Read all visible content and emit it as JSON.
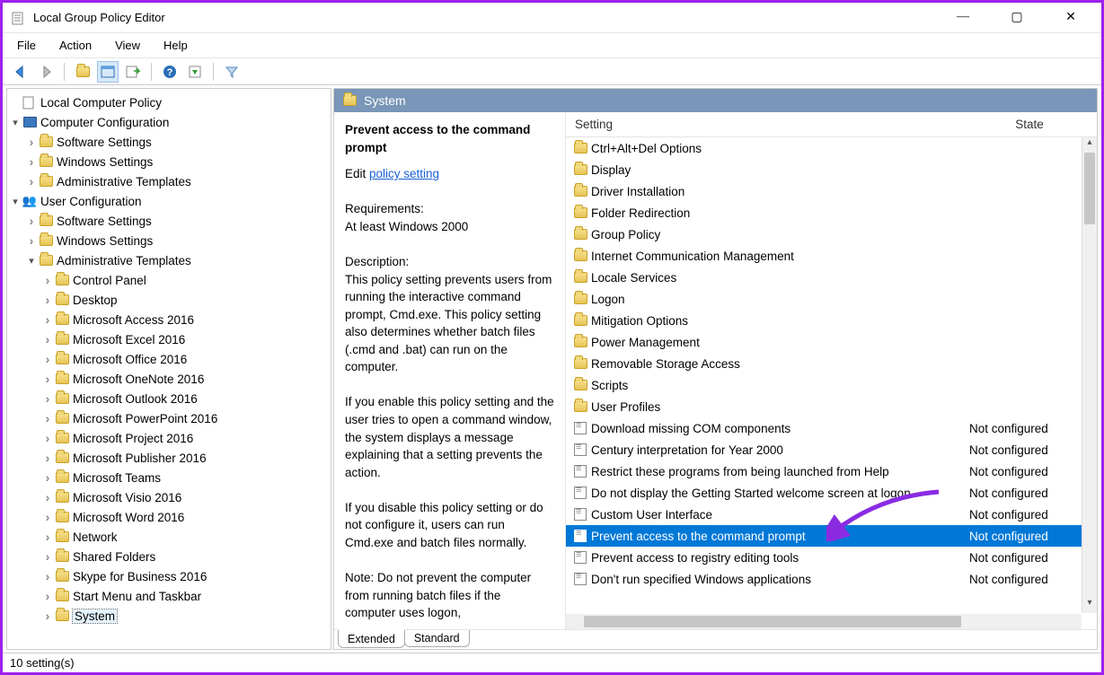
{
  "window": {
    "title": "Local Group Policy Editor",
    "controls": {
      "min": "—",
      "max": "▢",
      "close": "✕"
    }
  },
  "menu": [
    "File",
    "Action",
    "View",
    "Help"
  ],
  "tree": {
    "root": "Local Computer Policy",
    "computer_cfg": "Computer Configuration",
    "cc_children": [
      "Software Settings",
      "Windows Settings",
      "Administrative Templates"
    ],
    "user_cfg": "User Configuration",
    "uc_children": [
      "Software Settings",
      "Windows Settings"
    ],
    "uc_admin": "Administrative Templates",
    "admin_children": [
      "Control Panel",
      "Desktop",
      "Microsoft Access 2016",
      "Microsoft Excel 2016",
      "Microsoft Office 2016",
      "Microsoft OneNote 2016",
      "Microsoft Outlook 2016",
      "Microsoft PowerPoint 2016",
      "Microsoft Project 2016",
      "Microsoft Publisher 2016",
      "Microsoft Teams",
      "Microsoft Visio 2016",
      "Microsoft Word 2016",
      "Network",
      "Shared Folders",
      "Skype for Business 2016",
      "Start Menu and Taskbar",
      "System"
    ]
  },
  "path_header": "System",
  "description": {
    "title": "Prevent access to the command prompt",
    "edit_prefix": "Edit ",
    "edit_link": "policy setting",
    "req_label": "Requirements:",
    "req_text": "At least Windows 2000",
    "desc_label": "Description:",
    "desc_p1": "This policy setting prevents users from running the interactive command prompt, Cmd.exe.  This policy setting also determines whether batch files (.cmd and .bat) can run on the computer.",
    "desc_p2": "If you enable this policy setting and the user tries to open a command window, the system displays a message explaining that a setting prevents the action.",
    "desc_p3": "If you disable this policy setting or do not configure it, users can run Cmd.exe and batch files normally.",
    "desc_p4": "Note: Do not prevent the computer from running batch files if the computer uses logon,"
  },
  "columns": {
    "setting": "Setting",
    "state": "State"
  },
  "folders": [
    "Ctrl+Alt+Del Options",
    "Display",
    "Driver Installation",
    "Folder Redirection",
    "Group Policy",
    "Internet Communication Management",
    "Locale Services",
    "Logon",
    "Mitigation Options",
    "Power Management",
    "Removable Storage Access",
    "Scripts",
    "User Profiles"
  ],
  "policies": [
    {
      "name": "Download missing COM components",
      "state": "Not configured"
    },
    {
      "name": "Century interpretation for Year 2000",
      "state": "Not configured"
    },
    {
      "name": "Restrict these programs from being launched from Help",
      "state": "Not configured"
    },
    {
      "name": "Do not display the Getting Started welcome screen at logon",
      "state": "Not configured"
    },
    {
      "name": "Custom User Interface",
      "state": "Not configured"
    },
    {
      "name": "Prevent access to the command prompt",
      "state": "Not configured",
      "selected": true
    },
    {
      "name": "Prevent access to registry editing tools",
      "state": "Not configured"
    },
    {
      "name": "Don't run specified Windows applications",
      "state": "Not configured"
    }
  ],
  "tabs": {
    "extended": "Extended",
    "standard": "Standard"
  },
  "status": "10 setting(s)"
}
